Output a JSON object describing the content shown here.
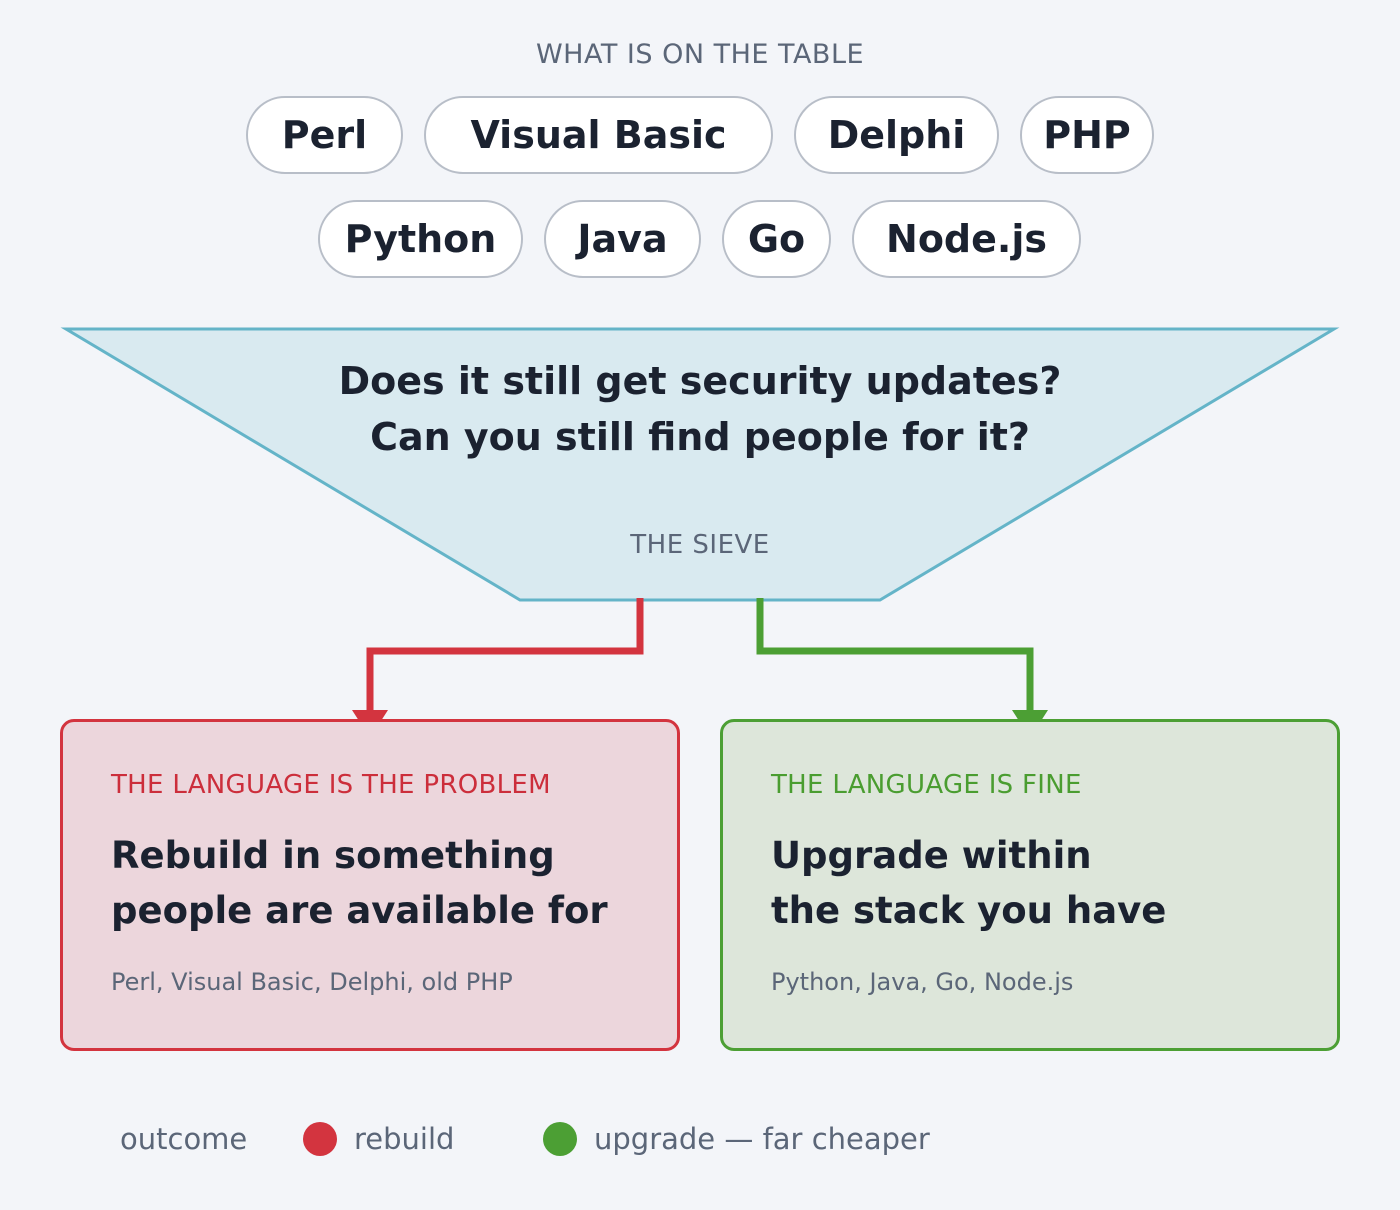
{
  "candidates": {
    "heading": "WHAT IS ON THE TABLE",
    "row1": [
      "Perl",
      "Visual Basic",
      "Delphi",
      "PHP"
    ],
    "row2": [
      "Python",
      "Java",
      "Go",
      "Node.js"
    ]
  },
  "sieve": {
    "question_1": "Does it still get security updates?",
    "question_2": "Can you still find people for it?",
    "label": "THE SIEVE",
    "fill_color": "#d9eaf0",
    "stroke_color": "#64b4c8"
  },
  "outcomes": {
    "rebuild": {
      "kicker": "THE LANGUAGE IS THE PROBLEM",
      "title_line_1": "Rebuild in something",
      "title_line_2": "people are available for",
      "detail": "Perl, Visual Basic, Delphi, old PHP",
      "color": "#d3343f"
    },
    "upgrade": {
      "kicker": "THE LANGUAGE IS FINE",
      "title_line_1": "Upgrade within",
      "title_line_2": "the stack you have",
      "detail": "Python, Java, Go, Node.js",
      "color": "#4c9f34"
    }
  },
  "legend": {
    "title": "outcome",
    "items": [
      {
        "label": "rebuild",
        "color": "#d3343f"
      },
      {
        "label": "upgrade — far cheaper",
        "color": "#4c9f34"
      }
    ]
  }
}
